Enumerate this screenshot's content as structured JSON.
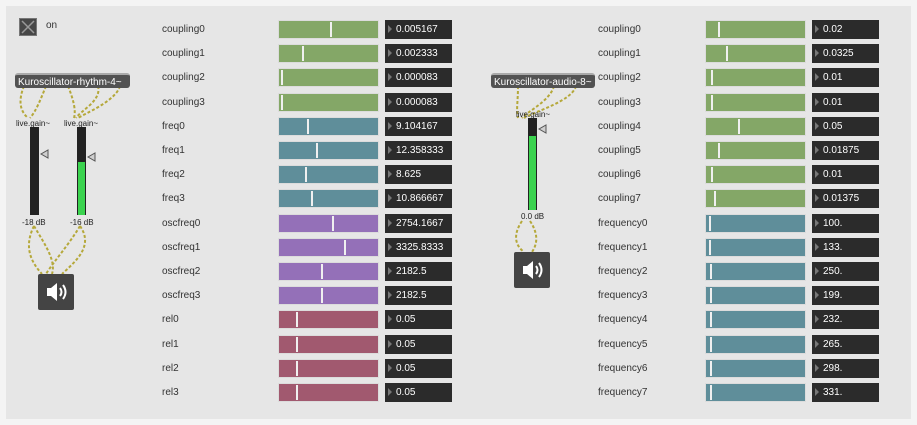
{
  "toggle": {
    "label": "on"
  },
  "objects": {
    "rhythm": "Kuroscillator-rhythm-4~",
    "audio": "Kuroscillator-audio-8~"
  },
  "gains": {
    "left_gain1": {
      "label": "live.gain~",
      "db": "-18 dB",
      "level": 0
    },
    "left_gain2": {
      "label": "live.gain~",
      "db": "-16 dB",
      "level": 0.62
    },
    "audio_gain": {
      "label": "live.gain~",
      "db": "0.0 dB",
      "level": 0.82
    }
  },
  "colors": {
    "green": "#84a767",
    "teal": "#5f8e9a",
    "purple": "#9470b8",
    "mauve": "#a1596f",
    "meter_green": "#3bd34f",
    "number_bg": "#2b2b2b"
  },
  "left_params": [
    {
      "label": "coupling0",
      "value": "0.005167",
      "color": "green",
      "level": 0.52
    },
    {
      "label": "coupling1",
      "value": "0.002333",
      "color": "green",
      "level": 0.22
    },
    {
      "label": "coupling2",
      "value": "0.000083",
      "color": "green",
      "level": 0
    },
    {
      "label": "coupling3",
      "value": "0.000083",
      "color": "green",
      "level": 0
    },
    {
      "label": "freq0",
      "value": "9.104167",
      "color": "teal",
      "level": 0.27
    },
    {
      "label": "freq1",
      "value": "12.358333",
      "color": "teal",
      "level": 0.37
    },
    {
      "label": "freq2",
      "value": "8.625",
      "color": "teal",
      "level": 0.25
    },
    {
      "label": "freq3",
      "value": "10.866667",
      "color": "teal",
      "level": 0.32
    },
    {
      "label": "oscfreq0",
      "value": "2754.1667",
      "color": "purple",
      "level": 0.54
    },
    {
      "label": "oscfreq1",
      "value": "3325.8333",
      "color": "purple",
      "level": 0.66
    },
    {
      "label": "oscfreq2",
      "value": "2182.5",
      "color": "purple",
      "level": 0.42
    },
    {
      "label": "oscfreq3",
      "value": "2182.5",
      "color": "purple",
      "level": 0.42
    },
    {
      "label": "rel0",
      "value": "0.05",
      "color": "mauve",
      "level": 0.16
    },
    {
      "label": "rel1",
      "value": "0.05",
      "color": "mauve",
      "level": 0.16
    },
    {
      "label": "rel2",
      "value": "0.05",
      "color": "mauve",
      "level": 0.16
    },
    {
      "label": "rel3",
      "value": "0.05",
      "color": "mauve",
      "level": 0.16
    }
  ],
  "right_params": [
    {
      "label": "coupling0",
      "value": "0.02",
      "color": "green",
      "level": 0.1
    },
    {
      "label": "coupling1",
      "value": "0.0325",
      "color": "green",
      "level": 0.19
    },
    {
      "label": "coupling2",
      "value": "0.01",
      "color": "green",
      "level": 0.03
    },
    {
      "label": "coupling3",
      "value": "0.01",
      "color": "green",
      "level": 0.03
    },
    {
      "label": "coupling4",
      "value": "0.05",
      "color": "green",
      "level": 0.32
    },
    {
      "label": "coupling5",
      "value": "0.01875",
      "color": "green",
      "level": 0.1
    },
    {
      "label": "coupling6",
      "value": "0.01",
      "color": "green",
      "level": 0.03
    },
    {
      "label": "coupling7",
      "value": "0.01375",
      "color": "green",
      "level": 0.06
    },
    {
      "label": "frequency0",
      "value": "100.",
      "color": "teal",
      "level": 0.01
    },
    {
      "label": "frequency1",
      "value": "133.",
      "color": "teal",
      "level": 0.01
    },
    {
      "label": "frequency2",
      "value": "250.",
      "color": "teal",
      "level": 0.02
    },
    {
      "label": "frequency3",
      "value": "199.",
      "color": "teal",
      "level": 0.02
    },
    {
      "label": "frequency4",
      "value": "232.",
      "color": "teal",
      "level": 0.02
    },
    {
      "label": "frequency5",
      "value": "265.",
      "color": "teal",
      "level": 0.02
    },
    {
      "label": "frequency6",
      "value": "298.",
      "color": "teal",
      "level": 0.02
    },
    {
      "label": "frequency7",
      "value": "331.",
      "color": "teal",
      "level": 0.02
    }
  ]
}
